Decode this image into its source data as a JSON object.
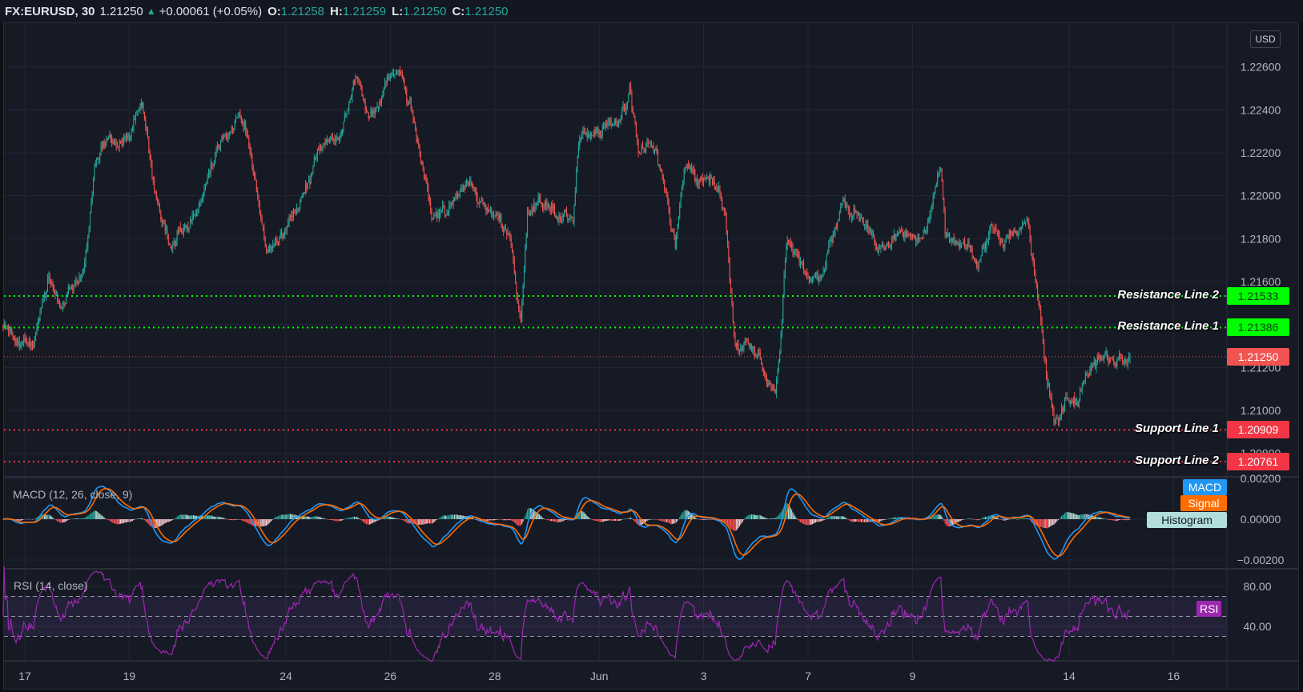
{
  "header": {
    "symbol": "FX:EURUSD, 30",
    "last": "1.21250",
    "change": "+0.00061 (+0.05%)",
    "o_label": "O:",
    "o": "1.21258",
    "h_label": "H:",
    "h": "1.21259",
    "l_label": "L:",
    "l": "1.21250",
    "c_label": "C:",
    "c": "1.21250",
    "direction_icon": "triangle-up-icon"
  },
  "price_axis": {
    "currency": "USD",
    "ticks": [
      "1.22600",
      "1.22400",
      "1.22200",
      "1.22000",
      "1.21800",
      "1.21600",
      "1.21400",
      "1.21200",
      "1.21000",
      "1.20800"
    ],
    "current_price": "1.21250",
    "current_color": "#f05350"
  },
  "levels": [
    {
      "label": "Resistance Line 2",
      "value": "1.21533",
      "color": "#00ff00",
      "text_color": "#0b3d0b"
    },
    {
      "label": "Resistance Line 1",
      "value": "1.21386",
      "color": "#00ff00",
      "text_color": "#0b3d0b"
    },
    {
      "label": "Support Line 1",
      "value": "1.20909",
      "color": "#f23645",
      "text_color": "#ffffff"
    },
    {
      "label": "Support Line 2",
      "value": "1.20761",
      "color": "#f23645",
      "text_color": "#ffffff"
    }
  ],
  "macd": {
    "legend": "MACD (12, 26, close, 9)",
    "ticks": [
      "0.00200",
      "0.00000",
      "−0.00200"
    ],
    "tags": [
      {
        "label": "MACD",
        "color": "#2196f3",
        "text_color": "#ffffff"
      },
      {
        "label": "Signal",
        "color": "#ff6d00",
        "text_color": "#ffffff"
      },
      {
        "label": "Histogram",
        "color": "#b2dfdb",
        "text_color": "#131722"
      }
    ]
  },
  "rsi": {
    "legend": "RSI (14, close)",
    "ticks": [
      "80.00",
      "40.00"
    ],
    "tag": "RSI",
    "color": "#9c27b0",
    "band": [
      30,
      70
    ]
  },
  "time_axis": {
    "ticks": [
      "17",
      "19",
      "24",
      "26",
      "28",
      "Jun",
      "3",
      "7",
      "9",
      "14",
      "16"
    ]
  },
  "chart_data": {
    "type": "candlestick",
    "symbol": "FX:EURUSD",
    "interval": "30",
    "up_color": "#26a69a",
    "down_color": "#ef5350",
    "ylim": [
      1.207,
      1.2268
    ],
    "grid": true,
    "path": [
      [
        "May 14 14:00",
        1.214
      ],
      [
        "May 17 04:00",
        1.2129
      ],
      [
        "May 17 11:00",
        1.2163
      ],
      [
        "May 17 17:00",
        1.2148
      ],
      [
        "May 18 03:00",
        1.2165
      ],
      [
        "May 18 08:00",
        1.2213
      ],
      [
        "May 18 12:00",
        1.2224
      ],
      [
        "May 18 22:00",
        1.2226
      ],
      [
        "May 19 06:00",
        1.2242
      ],
      [
        "May 19 11:00",
        1.2206
      ],
      [
        "May 19 19:00",
        1.2175
      ],
      [
        "May 20 08:00",
        1.2194
      ],
      [
        "May 20 18:00",
        1.2225
      ],
      [
        "May 21 03:00",
        1.2238
      ],
      [
        "May 21 07:00",
        1.2223
      ],
      [
        "May 21 15:00",
        1.2175
      ],
      [
        "May 24 00:00",
        1.2183
      ],
      [
        "May 24 08:00",
        1.2202
      ],
      [
        "May 24 15:00",
        1.2221
      ],
      [
        "May 25 01:00",
        1.2229
      ],
      [
        "May 25 08:00",
        1.2255
      ],
      [
        "May 25 14:00",
        1.2236
      ],
      [
        "May 25 22:00",
        1.2253
      ],
      [
        "May 26 04:00",
        1.2259
      ],
      [
        "May 26 09:00",
        1.2244
      ],
      [
        "May 26 15:00",
        1.2213
      ],
      [
        "May 26 19:00",
        1.2188
      ],
      [
        "May 27 04:00",
        1.2197
      ],
      [
        "May 27 12:00",
        1.2206
      ],
      [
        "May 27 22:00",
        1.2193
      ],
      [
        "May 28 07:00",
        1.218
      ],
      [
        "May 28 12:00",
        1.2142
      ],
      [
        "May 28 15:00",
        1.2192
      ],
      [
        "May 31 00:00",
        1.2196
      ],
      [
        "May 31 12:00",
        1.2188
      ],
      [
        "May 31 15:00",
        1.2228
      ],
      [
        "Jun 1 09:00",
        1.2234
      ],
      [
        "Jun 1 14:00",
        1.2251
      ],
      [
        "Jun 1 18:00",
        1.2221
      ],
      [
        "Jun 2 02:00",
        1.2221
      ],
      [
        "Jun 2 07:00",
        1.2202
      ],
      [
        "Jun 2 11:00",
        1.2175
      ],
      [
        "Jun 2 15:00",
        1.2212
      ],
      [
        "Jun 3 03:00",
        1.2208
      ],
      [
        "Jun 3 10:00",
        1.2191
      ],
      [
        "Jun 3 14:00",
        1.2133
      ],
      [
        "Jun 3 22:00",
        1.2129
      ],
      [
        "Jun 4 09:00",
        1.2109
      ],
      [
        "Jun 4 11:00",
        1.2128
      ],
      [
        "Jun 4 14:00",
        1.2178
      ],
      [
        "Jun 4 22:00",
        1.2167
      ],
      [
        "Jun 7 06:00",
        1.216
      ],
      [
        "Jun 7 16:00",
        1.2198
      ],
      [
        "Jun 8 01:00",
        1.2187
      ],
      [
        "Jun 8 09:00",
        1.2175
      ],
      [
        "Jun 8 16:00",
        1.2181
      ],
      [
        "Jun 9 06:00",
        1.2183
      ],
      [
        "Jun 9 13:00",
        1.2213
      ],
      [
        "Jun 9 15:00",
        1.2183
      ],
      [
        "Jun 10 01:00",
        1.2177
      ],
      [
        "Jun 10 06:00",
        1.2168
      ],
      [
        "Jun 10 12:00",
        1.2187
      ],
      [
        "Jun 10 18:00",
        1.2177
      ],
      [
        "Jun 11 05:00",
        1.2189
      ],
      [
        "Jun 11 09:00",
        1.2157
      ],
      [
        "Jun 11 14:00",
        1.2113
      ],
      [
        "Jun 11 17:00",
        1.2096
      ],
      [
        "Jun 11 23:00",
        1.2106
      ],
      [
        "Jun 14 04:00",
        1.2102
      ],
      [
        "Jun 14 08:00",
        1.2117
      ],
      [
        "Jun 14 14:00",
        1.2127
      ],
      [
        "Jun 14 21:00",
        1.2121
      ],
      [
        "Jun 15 04:00",
        1.2125
      ]
    ]
  }
}
